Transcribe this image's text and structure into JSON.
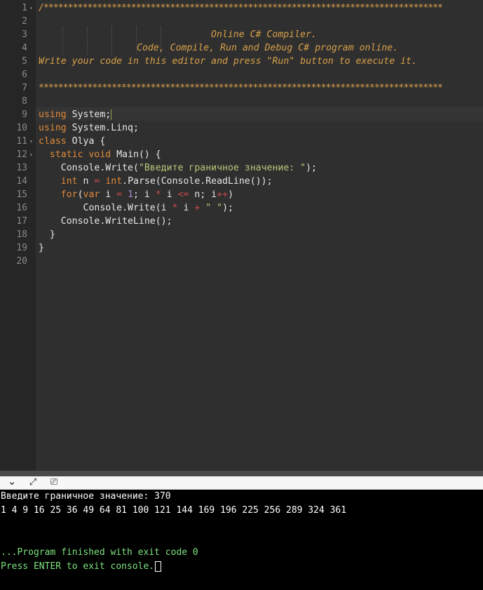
{
  "editor": {
    "line_numbers": [
      "1",
      "2",
      "3",
      "4",
      "5",
      "6",
      "7",
      "8",
      "9",
      "10",
      "11",
      "12",
      "13",
      "14",
      "15",
      "16",
      "17",
      "18",
      "19",
      "20"
    ],
    "comment": {
      "stars_open": "/**********************************************************************************",
      "line3": "Online C# Compiler.",
      "line4": "Code, Compile, Run and Debug C# program online.",
      "line5": "Write your code in this editor and press \"Run\" button to execute it.",
      "stars_close": "***********************************************************************************"
    },
    "code": {
      "l9_kw": "using",
      "l9_rest": " System;",
      "l10_kw": "using",
      "l10_rest": " System.Linq;",
      "l11_kw": "class",
      "l11_rest": " Olya {",
      "l12_kw1": "static",
      "l12_kw2": "void",
      "l12_rest": " Main() {",
      "l13_a": "Console.Write(",
      "l13_str": "\"Введите граничное значение: \"",
      "l13_b": ");",
      "l14_kw": "int",
      "l14_a": " n ",
      "l14_op": "=",
      "l14_kw2": " int",
      "l14_b": ".Parse(Console.ReadLine());",
      "l15_kw": "for",
      "l15_a": "(",
      "l15_kw2": "var",
      "l15_b": " i ",
      "l15_op1": "=",
      "l15_num": " 1",
      "l15_c": "; i ",
      "l15_op2": "*",
      "l15_d": " i ",
      "l15_op3": "<=",
      "l15_e": " n; i",
      "l15_op4": "++",
      "l15_f": ")",
      "l16_a": "Console.Write(i ",
      "l16_op1": "*",
      "l16_b": " i ",
      "l16_op2": "+",
      "l16_str": " \" \"",
      "l16_c": ");",
      "l17": "Console.WriteLine();",
      "l18": "}",
      "l19": "}"
    }
  },
  "console_toolbar": {
    "collapse_icon": "chevron-down-icon",
    "expand_icon": "expand-icon",
    "clear_icon": "clear-console-icon",
    "glyph_collapse": "⌄",
    "glyph_expand": "⤢",
    "glyph_clear": "⎚"
  },
  "console": {
    "line1": "Введите граничное значение: 370",
    "line2": "1 4 9 16 25 36 49 64 81 100 121 144 169 196 225 256 289 324 361",
    "finished": "...Program finished with exit code 0",
    "press_enter": "Press ENTER to exit console."
  },
  "colors": {
    "comment": "#d8a04a",
    "keyword": "#df8a3a",
    "string": "#b5c97a",
    "number": "#ad88d6",
    "operator": "#c74b4b",
    "console_green": "#7fe27f"
  }
}
